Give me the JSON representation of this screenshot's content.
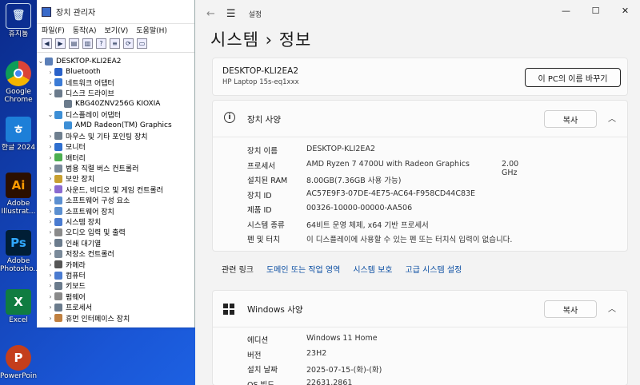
{
  "desktop": {
    "icons": [
      {
        "label": "휴지통",
        "name": "recycle-bin"
      },
      {
        "label": "Google Chrome",
        "name": "chrome"
      },
      {
        "label": "한글 2024",
        "name": "hangul"
      },
      {
        "label": "Adobe Illustrat...",
        "name": "illustrator"
      },
      {
        "label": "Adobe Photosho...",
        "name": "photoshop"
      },
      {
        "label": "Excel",
        "name": "excel"
      },
      {
        "label": "PowerPoint",
        "name": "powerpoint"
      }
    ]
  },
  "device_manager": {
    "title": "장치 관리자",
    "menu": [
      "파일(F)",
      "동작(A)",
      "보기(V)",
      "도움말(H)"
    ],
    "root": "DESKTOP-KLI2EA2",
    "nodes": [
      {
        "label": "Bluetooth",
        "arrow": ">",
        "indent": 1
      },
      {
        "label": "네트워크 어댑터",
        "arrow": ">",
        "indent": 1
      },
      {
        "label": "디스크 드라이브",
        "arrow": "v",
        "indent": 1
      },
      {
        "label": "KBG40ZNV256G KIOXIA",
        "arrow": "",
        "indent": 2
      },
      {
        "label": "디스플레이 어댑터",
        "arrow": "v",
        "indent": 1
      },
      {
        "label": "AMD Radeon(TM) Graphics",
        "arrow": "",
        "indent": 2
      },
      {
        "label": "마우스 및 기타 포인팅 장치",
        "arrow": ">",
        "indent": 1
      },
      {
        "label": "모니터",
        "arrow": ">",
        "indent": 1
      },
      {
        "label": "배터리",
        "arrow": ">",
        "indent": 1
      },
      {
        "label": "범용 직렬 버스 컨트롤러",
        "arrow": ">",
        "indent": 1
      },
      {
        "label": "보안 장치",
        "arrow": ">",
        "indent": 1
      },
      {
        "label": "사운드, 비디오 및 게임 컨트롤러",
        "arrow": ">",
        "indent": 1
      },
      {
        "label": "소프트웨어 구성 요소",
        "arrow": ">",
        "indent": 1
      },
      {
        "label": "소프트웨어 장치",
        "arrow": ">",
        "indent": 1
      },
      {
        "label": "시스템 장치",
        "arrow": ">",
        "indent": 1
      },
      {
        "label": "오디오 입력 및 출력",
        "arrow": ">",
        "indent": 1
      },
      {
        "label": "인쇄 대기열",
        "arrow": ">",
        "indent": 1
      },
      {
        "label": "저장소 컨트롤러",
        "arrow": ">",
        "indent": 1
      },
      {
        "label": "카메라",
        "arrow": ">",
        "indent": 1
      },
      {
        "label": "컴퓨터",
        "arrow": ">",
        "indent": 1
      },
      {
        "label": "키보드",
        "arrow": ">",
        "indent": 1
      },
      {
        "label": "펌웨어",
        "arrow": ">",
        "indent": 1
      },
      {
        "label": "프로세서",
        "arrow": ">",
        "indent": 1
      },
      {
        "label": "휴먼 인터페이스 장치",
        "arrow": ">",
        "indent": 1
      }
    ]
  },
  "settings": {
    "app_title": "설정",
    "breadcrumb": "시스템  ›  정보",
    "pc_name": "DESKTOP-KLI2EA2",
    "pc_model": "HP Laptop 15s-eq1xxx",
    "rename_button": "이 PC의 이름 바꾸기",
    "device_spec": {
      "title": "장치 사양",
      "copy_button": "복사",
      "rows": [
        {
          "key": "장치 이름",
          "value": "DESKTOP-KLI2EA2",
          "extra": ""
        },
        {
          "key": "프로세서",
          "value": "AMD Ryzen 7 4700U with Radeon Graphics",
          "extra": "2.00 GHz"
        },
        {
          "key": "설치된 RAM",
          "value": "8.00GB(7.36GB 사용 가능)",
          "extra": ""
        },
        {
          "key": "장치 ID",
          "value": "AC57E9F3-07DE-4E75-AC64-F958CD44C83E",
          "extra": ""
        },
        {
          "key": "제품 ID",
          "value": "00326-10000-00000-AA506",
          "extra": ""
        },
        {
          "key": "시스템 종류",
          "value": "64비트 운영 체제, x64 기반 프로세서",
          "extra": ""
        },
        {
          "key": "펜 및 터치",
          "value": "이 디스플레이에 사용할 수 있는 펜 또는 터치식 입력이 없습니다.",
          "extra": ""
        }
      ]
    },
    "related_links": {
      "title": "관련 링크",
      "links": [
        "도메인 또는 작업 영역",
        "시스템 보호",
        "고급 시스템 설정"
      ]
    },
    "windows_spec": {
      "title": "Windows 사양",
      "copy_button": "복사",
      "rows": [
        {
          "key": "에디션",
          "value": "Windows 11 Home"
        },
        {
          "key": "버전",
          "value": "23H2"
        },
        {
          "key": "설치 날짜",
          "value": "2025-07-15-(화)-(화)"
        },
        {
          "key": "OS 빌드",
          "value": "22631.2861"
        }
      ]
    }
  }
}
